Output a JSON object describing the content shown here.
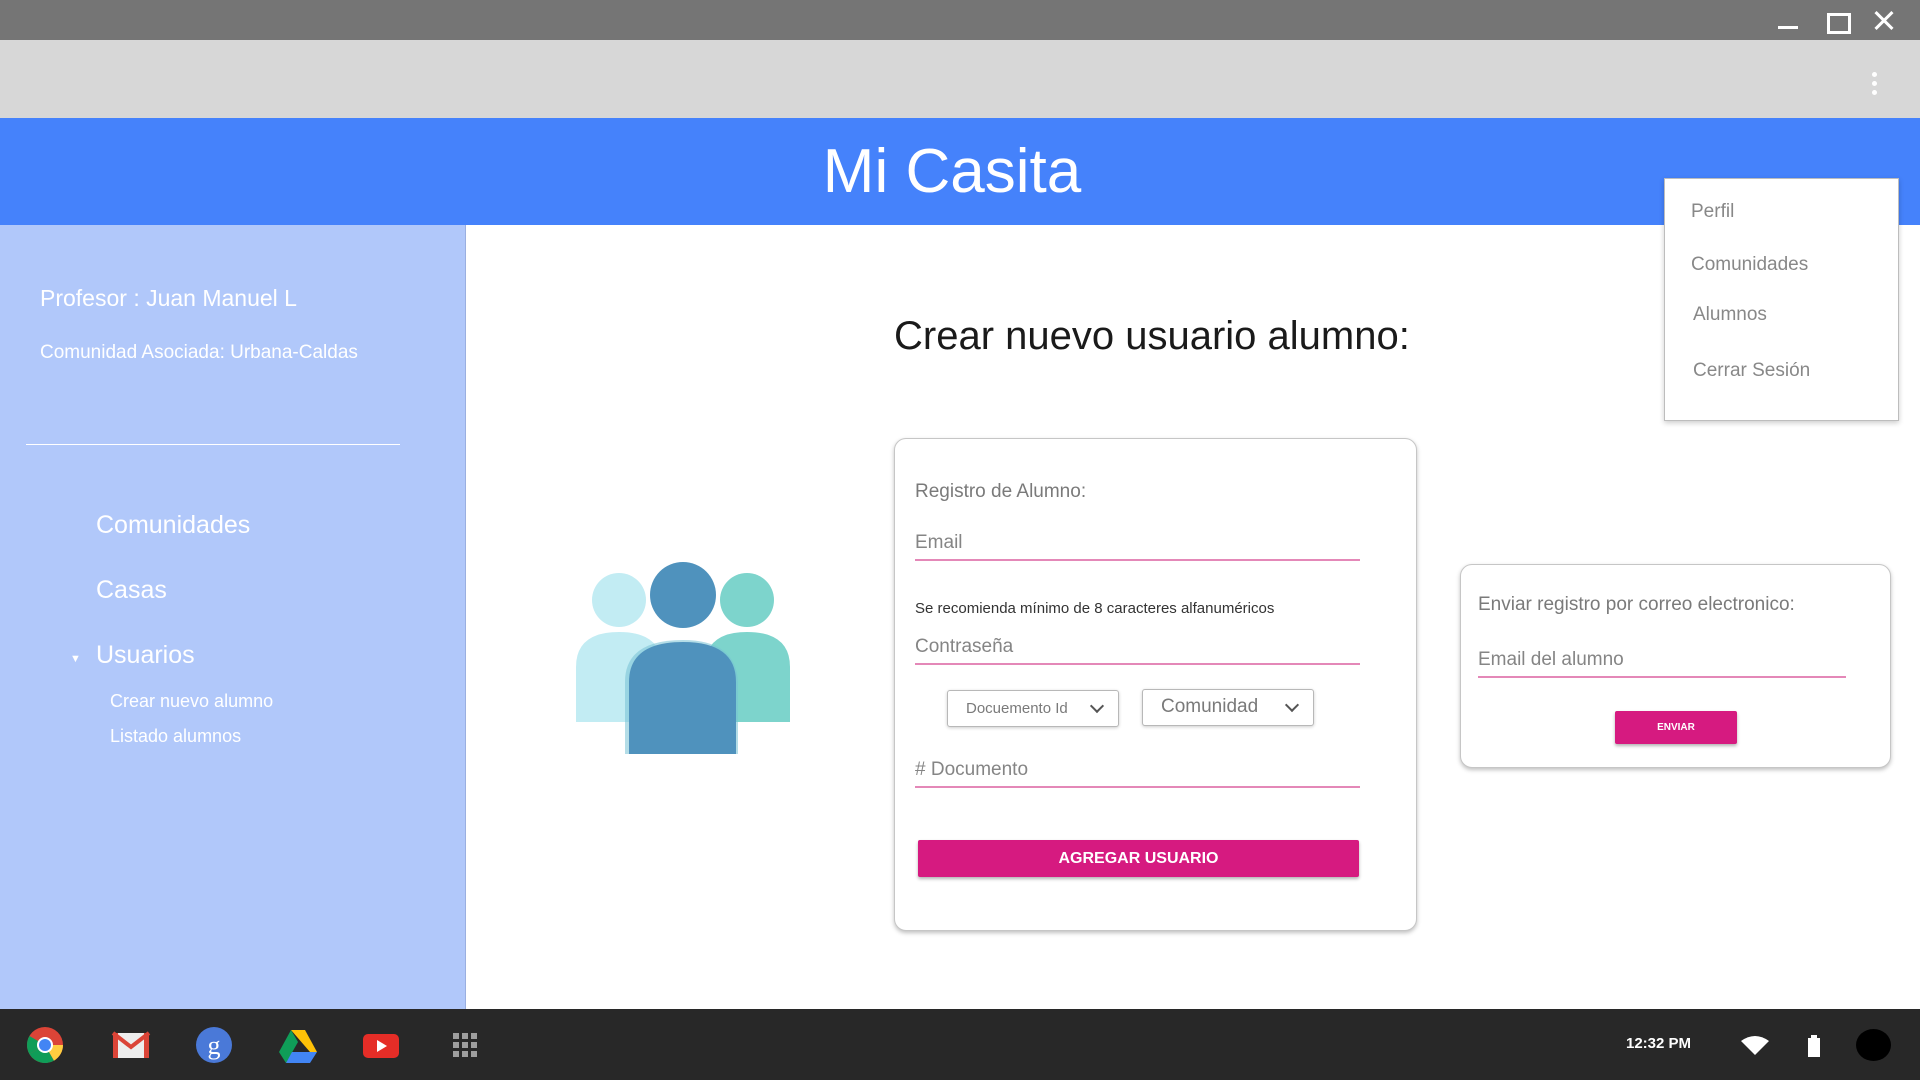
{
  "app": {
    "title": "Mi Casita"
  },
  "sidebar": {
    "profesor": "Profesor : Juan Manuel L",
    "comunidad_asociada": "Comunidad Asociada: Urbana-Caldas",
    "nav": [
      {
        "label": "Comunidades"
      },
      {
        "label": "Casas"
      },
      {
        "label": "Usuarios",
        "expanded": true,
        "children": [
          {
            "label": "Crear nuevo alumno"
          },
          {
            "label": "Listado alumnos"
          }
        ]
      }
    ]
  },
  "main": {
    "title": "Crear nuevo usuario alumno:",
    "registro": {
      "title": "Registro de Alumno:",
      "email_placeholder": "Email",
      "hint": "Se recomienda mínimo de 8 caracteres alfanuméricos",
      "password_placeholder": "Contraseña",
      "documento_select": "Docuemento Id",
      "comunidad_select": "Comunidad",
      "documento_placeholder": "# Documento",
      "submit_label": "AGREGAR USUARIO"
    },
    "enviar": {
      "title": "Enviar registro por correo electronico:",
      "email_placeholder": "Email del alumno",
      "submit_label": "ENVIAR"
    }
  },
  "menu": {
    "items": [
      {
        "label": "Perfil"
      },
      {
        "label": "Comunidades"
      },
      {
        "label": "Alumnos"
      },
      {
        "label": "Cerrar Sesión"
      }
    ]
  },
  "shelf": {
    "apps": [
      "chrome-icon",
      "gmail-icon",
      "google-plus-icon",
      "drive-icon",
      "youtube-icon",
      "app-launcher-icon"
    ],
    "time": "12:32 PM"
  },
  "colors": {
    "header": "#4582fb",
    "sidebar": "#b1c8fa",
    "accent": "#d61a80",
    "underline": "#e488b8"
  }
}
